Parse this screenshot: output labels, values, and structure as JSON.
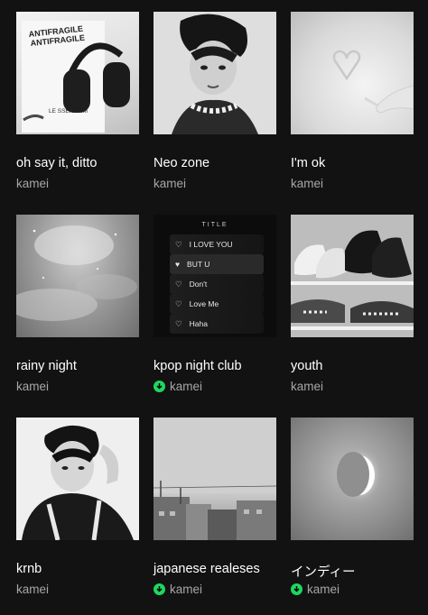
{
  "playlists": [
    {
      "title": "oh say it, ditto",
      "owner": "kamei",
      "downloaded": false,
      "cover_icon": "headphones-on-book",
      "cover_text": {
        "line1": "ANTIFRAGILE",
        "line2": "ANTIFRAGILE",
        "line3": "LE SSERAFIM"
      }
    },
    {
      "title": "Neo zone",
      "owner": "kamei",
      "downloaded": false,
      "cover_icon": "portrait-person"
    },
    {
      "title": "I'm ok",
      "owner": "kamei",
      "downloaded": false,
      "cover_icon": "heart-in-snow"
    },
    {
      "title": "rainy night",
      "owner": "kamei",
      "downloaded": false,
      "cover_icon": "night-sky"
    },
    {
      "title": "kpop night club",
      "owner": "kamei",
      "downloaded": true,
      "cover_icon": "song-list",
      "cover_text": {
        "head": "TITLE",
        "rows": [
          "I LOVE YOU",
          "BUT U",
          "Don't",
          "Love Me",
          "Haha"
        ]
      }
    },
    {
      "title": "youth",
      "owner": "kamei",
      "downloaded": false,
      "cover_icon": "shoe-rack"
    },
    {
      "title": "krnb",
      "owner": "kamei",
      "downloaded": false,
      "cover_icon": "portrait-person"
    },
    {
      "title": "japanese realeses",
      "owner": "kamei",
      "downloaded": true,
      "cover_icon": "city-skyline"
    },
    {
      "title": "インディー",
      "owner": "kamei",
      "downloaded": true,
      "cover_icon": "crescent-moon"
    }
  ],
  "colors": {
    "background": "#121212",
    "title": "#ffffff",
    "owner": "#a7a7a7",
    "download_badge": "#1ed760"
  }
}
